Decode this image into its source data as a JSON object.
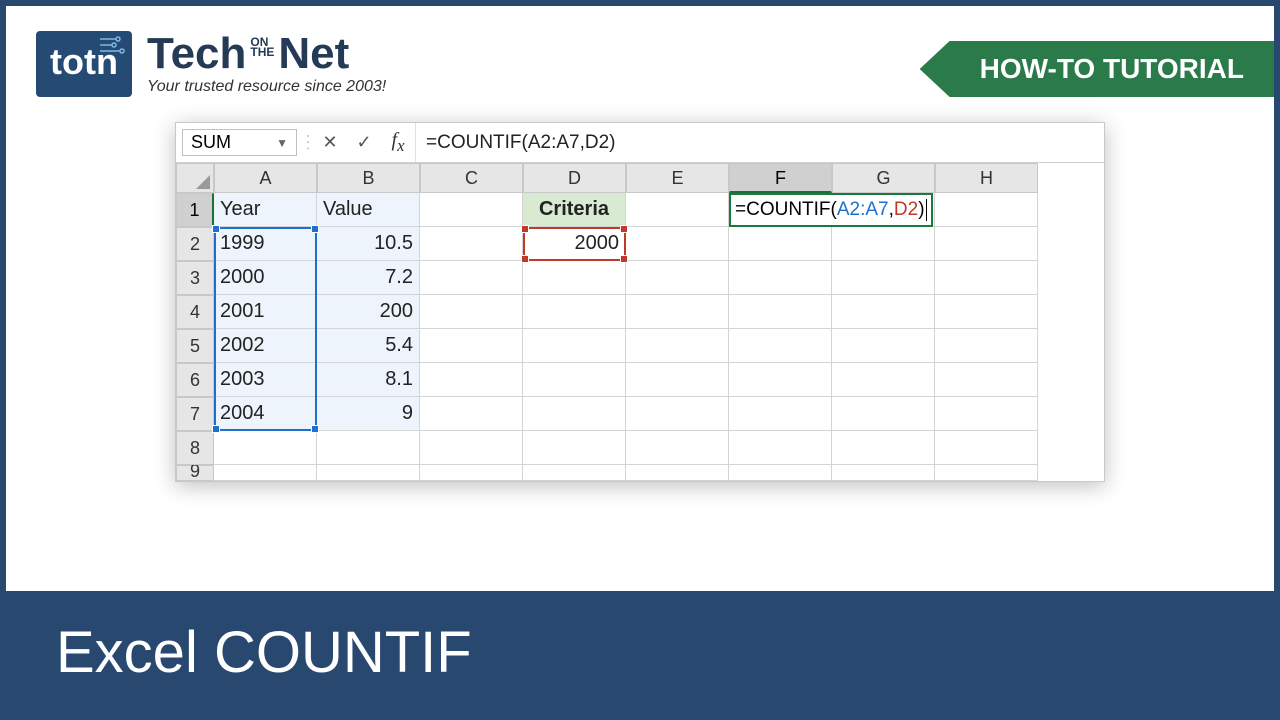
{
  "brand": {
    "mark": "totn",
    "name_part1": "Tech",
    "name_on": "ON",
    "name_the": "THE",
    "name_part2": "Net",
    "tagline": "Your trusted resource since 2003!"
  },
  "ribbon": {
    "label": "HOW-TO TUTORIAL"
  },
  "excel": {
    "name_box": "SUM",
    "formula": "=COUNTIF(A2:A7,D2)",
    "columns": [
      "A",
      "B",
      "C",
      "D",
      "E",
      "F",
      "G",
      "H"
    ],
    "row_numbers": [
      "1",
      "2",
      "3",
      "4",
      "5",
      "6",
      "7",
      "8",
      "9"
    ],
    "headers": {
      "A1": "Year",
      "B1": "Value",
      "D1": "Criteria"
    },
    "data": {
      "A": [
        "1999",
        "2000",
        "2001",
        "2002",
        "2003",
        "2004"
      ],
      "B": [
        "10.5",
        "7.2",
        "200",
        "5.4",
        "8.1",
        "9"
      ],
      "D2": "2000"
    },
    "active_formula": {
      "prefix": "=COUNTIF(",
      "arg1": "A2:A7",
      "comma": ",",
      "arg2": "D2",
      "suffix": ")"
    }
  },
  "footer": {
    "title": "Excel COUNTIF"
  }
}
